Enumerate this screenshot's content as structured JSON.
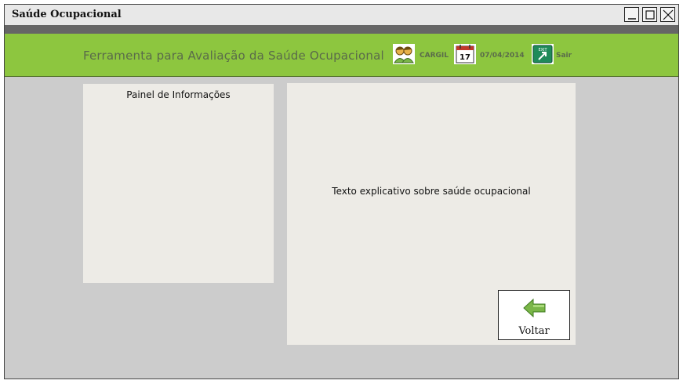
{
  "window": {
    "title": "Saúde Ocupacional",
    "controls": [
      "minimize-icon",
      "maximize-icon",
      "close-icon"
    ]
  },
  "header": {
    "app_title": "Ferramenta para Avaliação da Saúde Ocupacional",
    "company": "CARGIL",
    "company_icon": "users-icon",
    "date": "07/04/2014",
    "calendar_icon": "calendar-icon",
    "calendar_day": "17",
    "exit_icon_text": "EXIT",
    "exit_label": "Sair",
    "exit_icon": "exit-icon",
    "accent_color": "#8dc63f"
  },
  "info_panel": {
    "title": "Painel de Informações"
  },
  "content_panel": {
    "text": "Texto explicativo sobre saúde ocupacional",
    "back_button": {
      "label": "Voltar",
      "icon": "back-arrow-icon"
    }
  }
}
